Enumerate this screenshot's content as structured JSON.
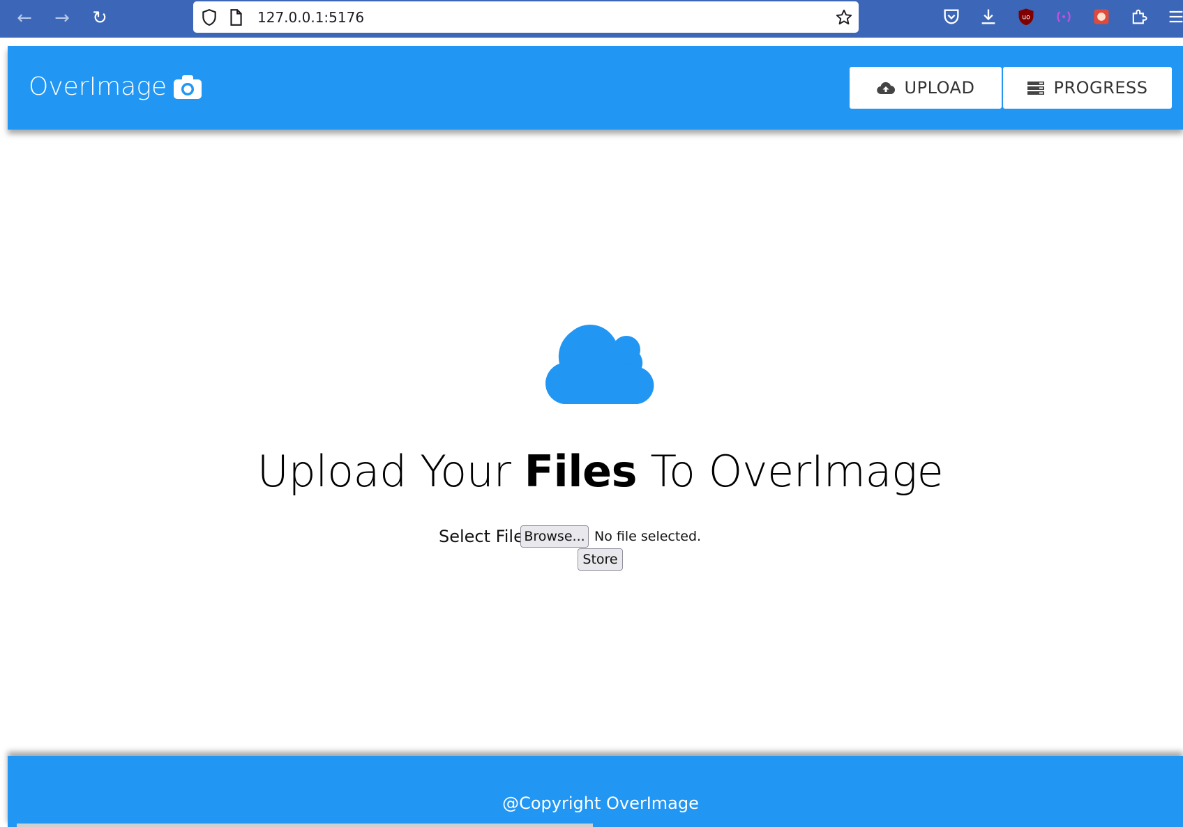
{
  "browser": {
    "url": "127.0.0.1:5176"
  },
  "header": {
    "brand": "OverImage",
    "upload_label": "UPLOAD",
    "progress_label": "PROGRESS",
    "color": "#2196f3"
  },
  "main": {
    "heading_pre": "Upload Your ",
    "heading_bold": "Files",
    "heading_post": " To OverImage",
    "select_label": "Select File",
    "browse_label": "Browse...",
    "file_status": "No file selected.",
    "store_label": "Store"
  },
  "footer": {
    "text": "@Copyright OverImage"
  }
}
